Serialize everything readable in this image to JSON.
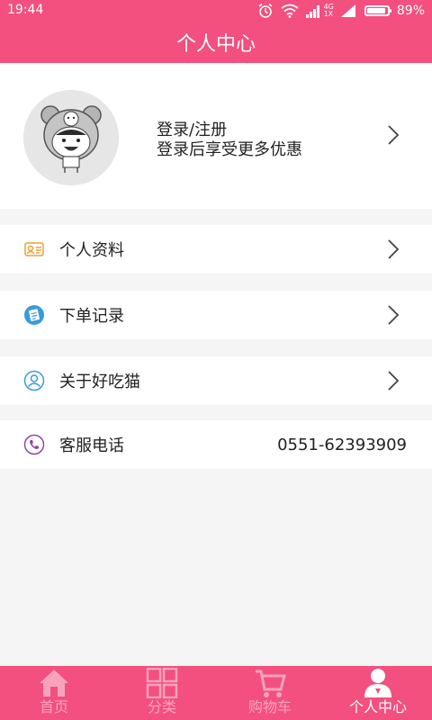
{
  "status_bar": {
    "time": "19:44",
    "net_4g": "4G",
    "net_1x": "1X",
    "battery": "89%",
    "battery_level": 0.89
  },
  "header": {
    "title": "个人中心"
  },
  "profile": {
    "login_text": "登录/注册",
    "subtitle": "登录后享受更多优惠"
  },
  "menu": {
    "personal_info": "个人资料",
    "order_records": "下单记录",
    "about": "关于好吃猫",
    "service": "客服电话",
    "service_phone": "0551-62393909"
  },
  "colors": {
    "brand": "#f34f7f",
    "tab_inactive": "#f8a3bd",
    "icon_orange": "#f0a030",
    "icon_blue": "#3a9bd9",
    "icon_purple": "#8e44ad"
  },
  "tabbar": {
    "home": "首页",
    "category": "分类",
    "cart": "购物车",
    "profile": "个人中心",
    "active": "profile"
  }
}
